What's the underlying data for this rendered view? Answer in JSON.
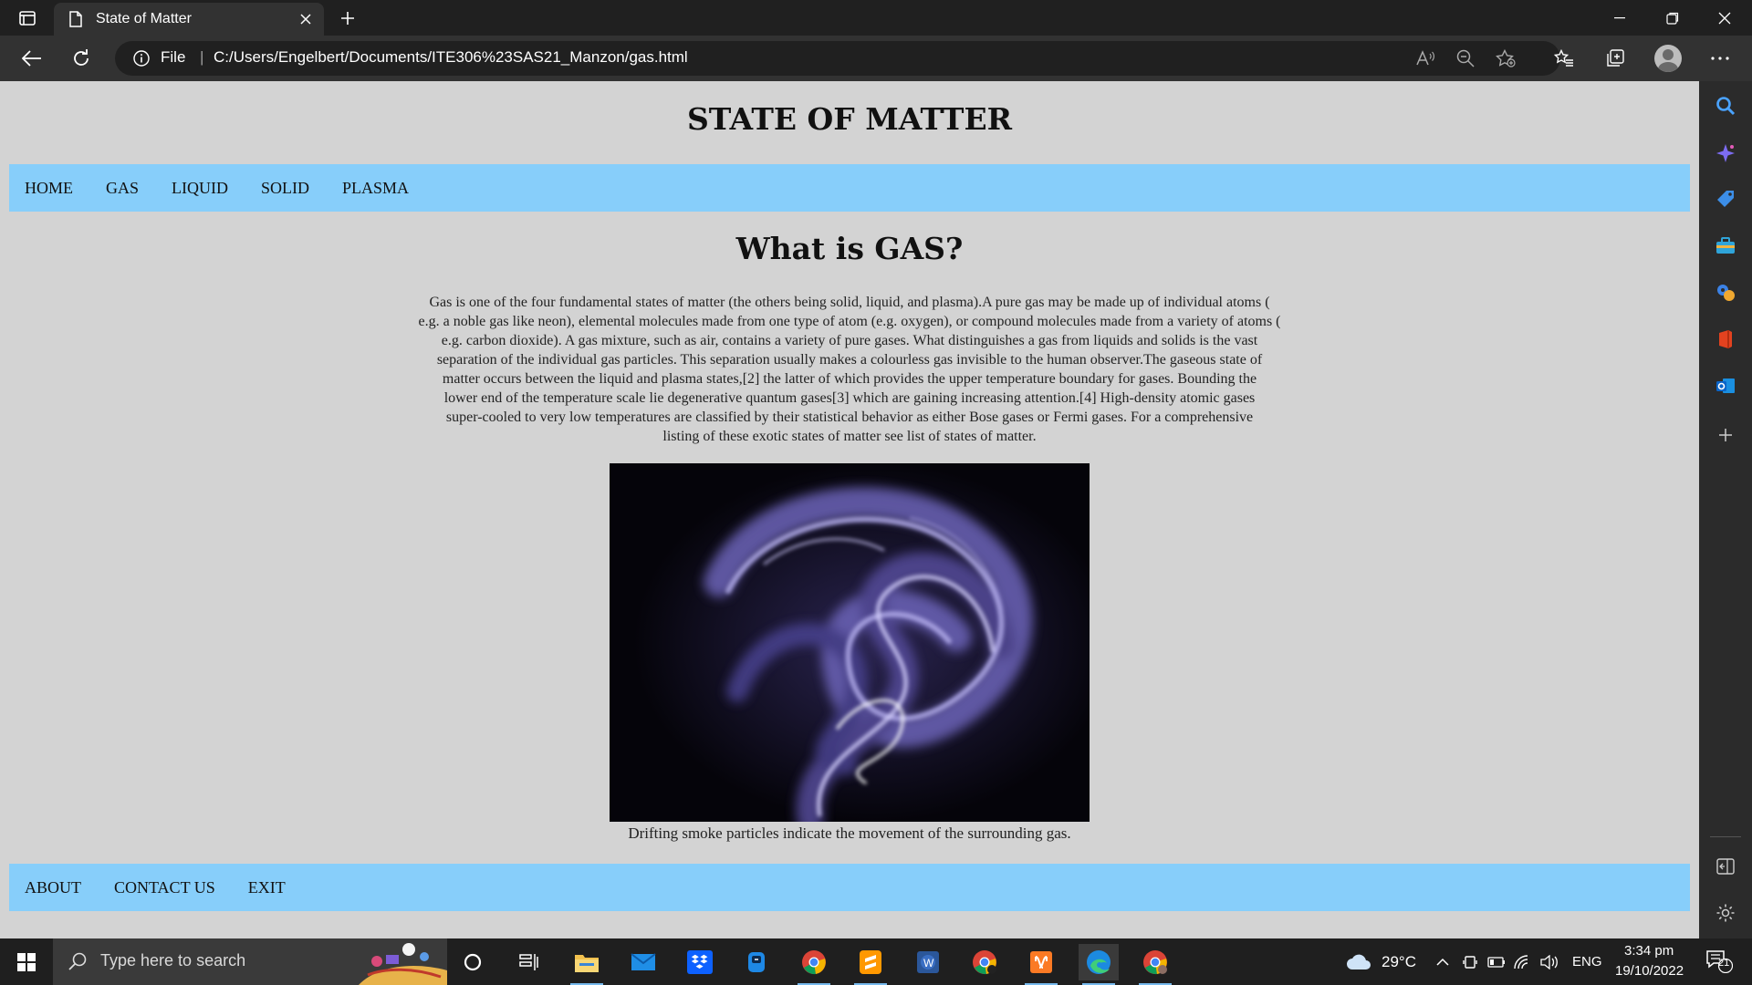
{
  "browser": {
    "tab_title": "State of Matter",
    "address": {
      "scheme_label": "File",
      "separator": "|",
      "url": "C:/Users/Engelbert/Documents/ITE306%23SAS21_Manzon/gas.html"
    }
  },
  "page": {
    "heading": "STATE OF MATTER",
    "nav": [
      "HOME",
      "GAS",
      "LIQUID",
      "SOLID",
      "PLASMA"
    ],
    "section_title": "What is GAS?",
    "article_lines": [
      "Gas is one of the four fundamental states of matter (the others being solid, liquid, and plasma).A pure gas may be made up of individual atoms (",
      "e.g. a noble gas like neon), elemental molecules made from one type of atom (e.g. oxygen), or compound molecules made from a variety of atoms (",
      "e.g. carbon dioxide). A gas mixture, such as air, contains a variety of pure gases. What distinguishes a gas from liquids and solids is the vast",
      "separation of the individual gas particles. This separation usually makes a colourless gas invisible to the human observer.The gaseous state of",
      "matter occurs between the liquid and plasma states,[2] the latter of which provides the upper temperature boundary for gases. Bounding the",
      "lower end of the temperature scale lie degenerative quantum gases[3] which are gaining increasing attention.[4] High-density atomic gases",
      "super-cooled to very low temperatures are classified by their statistical behavior as either Bose gases or Fermi gases. For a comprehensive",
      "listing of these exotic states of matter see list of states of matter."
    ],
    "figure_caption": "Drifting smoke particles indicate the movement of the surrounding gas.",
    "footer_links": [
      "ABOUT",
      "CONTACT US",
      "EXIT"
    ]
  },
  "taskbar": {
    "search_placeholder": "Type here to search",
    "weather": "29°C",
    "language": "ENG",
    "time": "3:34 pm",
    "date": "19/10/2022",
    "notification_count": "21"
  },
  "colors": {
    "nav_bar": "#87cefa",
    "page_background": "#d3d3d3",
    "browser_dark": "#202020"
  }
}
